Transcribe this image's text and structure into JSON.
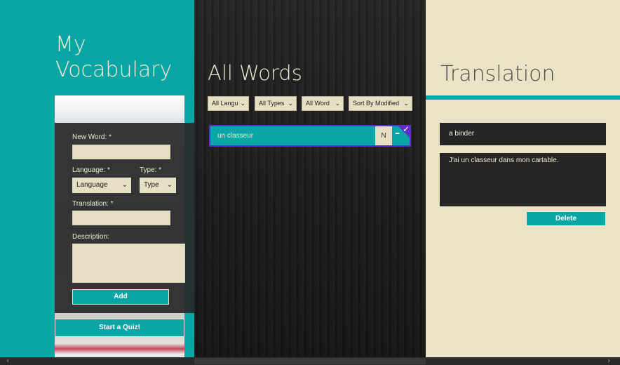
{
  "app": {
    "title_line1": "My",
    "title_line2": "Vocabulary"
  },
  "form": {
    "new_word_label": "New Word: *",
    "new_word_value": "",
    "language_label": "Language: *",
    "language_select": "Language",
    "type_label": "Type: *",
    "type_select": "Type",
    "translation_label": "Translation: *",
    "translation_value": "",
    "description_label": "Description:",
    "description_value": "",
    "add_button": "Add"
  },
  "quiz_button": "Start a Quiz!",
  "all_words": {
    "title": "All Words",
    "filters": [
      {
        "label": "All Langu"
      },
      {
        "label": "All Types"
      },
      {
        "label": "All Word"
      },
      {
        "label": "Sort By Modified"
      }
    ],
    "selected_word": {
      "word": "un classeur",
      "type": "N",
      "dash": "–",
      "selected_check": "✓"
    }
  },
  "translation_panel": {
    "title": "Translation",
    "translation_value": "a binder",
    "description_value": "J'ai un classeur dans mon cartable.",
    "delete_button": "Delete"
  },
  "colors": {
    "accent": "#0aa5a5",
    "cream": "#ebe3c5",
    "selection": "#5e2fc6",
    "dark": "#262626"
  },
  "icons": {
    "dropdown": "chevron-down-icon",
    "check": "check-icon",
    "scroll_left": "scroll-left-arrow-icon",
    "scroll_right": "scroll-right-arrow-icon"
  }
}
